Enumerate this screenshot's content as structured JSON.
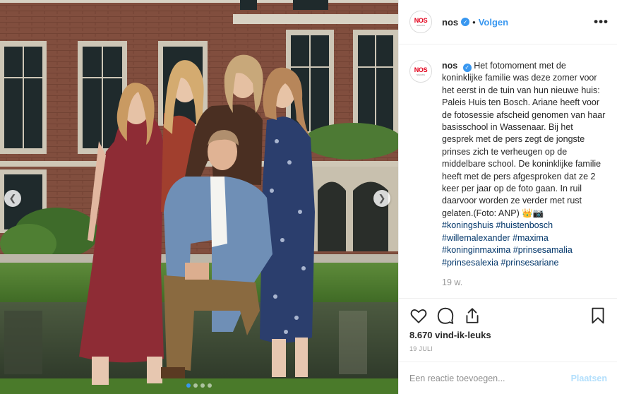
{
  "post": {
    "username": "nos",
    "separator": "•",
    "follow_label": "Volgen",
    "more_label": "•••",
    "avatar_logo": "NOS",
    "avatar_sub": "NIEUWS",
    "caption": "Het fotomoment met de koninklijke familie was deze zomer voor het eerst in de tuin van hun nieuwe huis: Paleis Huis ten Bosch. Ariane heeft voor de fotosessie afscheid genomen van haar basisschool in Wassenaar. Bij het gesprek met de pers zegt de jongste prinses zich te verheugen op de middelbare school. De koninklijke familie heeft met de pers afgesproken dat ze 2 keer per jaar op de foto gaan. In ruil daarvoor worden ze verder met rust gelaten.(Foto: ANP) 👑📷",
    "hashtags": [
      "#koningshuis",
      "#huistenbosch",
      "#willemalexander",
      "#maxima",
      "#koninginmaxima",
      "#prinsesamalia",
      "#prinsesalexia",
      "#prinsesariane"
    ],
    "time_ago": "19 w.",
    "likes": "8.670 vind-ik-leuks",
    "date": "19 juli",
    "comment_placeholder": "Een reactie toevoegen...",
    "post_label": "Plaatsen"
  },
  "icons": {
    "verified": "verified-badge-icon",
    "like": "heart-icon",
    "comment": "speech-bubble-icon",
    "share": "share-icon",
    "save": "bookmark-icon",
    "prev": "chevron-left-icon",
    "next": "chevron-right-icon"
  },
  "carousel": {
    "slide_count": 4,
    "active_index": 0
  },
  "colors": {
    "accent": "#3897f0",
    "hashtag": "#003569",
    "muted": "#999999",
    "brand_red": "#e3001b"
  }
}
